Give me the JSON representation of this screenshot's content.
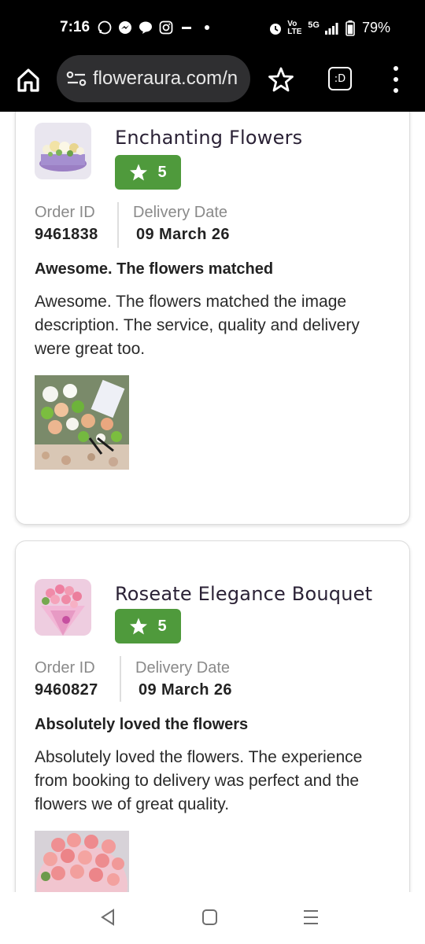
{
  "status_bar": {
    "time": "7:16",
    "left_icons": [
      "whatsapp-icon",
      "messenger-icon",
      "chat-icon",
      "instagram-icon",
      "sim-icon",
      "dot-icon"
    ],
    "network_label": "5G",
    "battery": "79%"
  },
  "browser": {
    "url": "floweraura.com/n",
    "tab_label": ":D"
  },
  "reviews": [
    {
      "product_name": "Enchanting Flowers",
      "rating": "5",
      "order_id_label": "Order ID",
      "order_id": "9461838",
      "delivery_date_label": "Delivery Date",
      "delivery_date": "09 March 26",
      "title": "Awesome. The flowers matched",
      "body": "Awesome. The flowers matched the image description. The service, quality and delivery were great too."
    },
    {
      "product_name": "Roseate Elegance Bouquet",
      "rating": "5",
      "order_id_label": "Order ID",
      "order_id": "9460827",
      "delivery_date_label": "Delivery Date",
      "delivery_date": "09 March 26",
      "title": "Absolutely loved the flowers",
      "body": "Absolutely loved the flowers. The experience from booking to delivery was perfect and the flowers we of great quality."
    }
  ],
  "colors": {
    "rating_badge": "#4f9a3c",
    "product_name": "#2b2236",
    "browser_bar": "#000000"
  }
}
